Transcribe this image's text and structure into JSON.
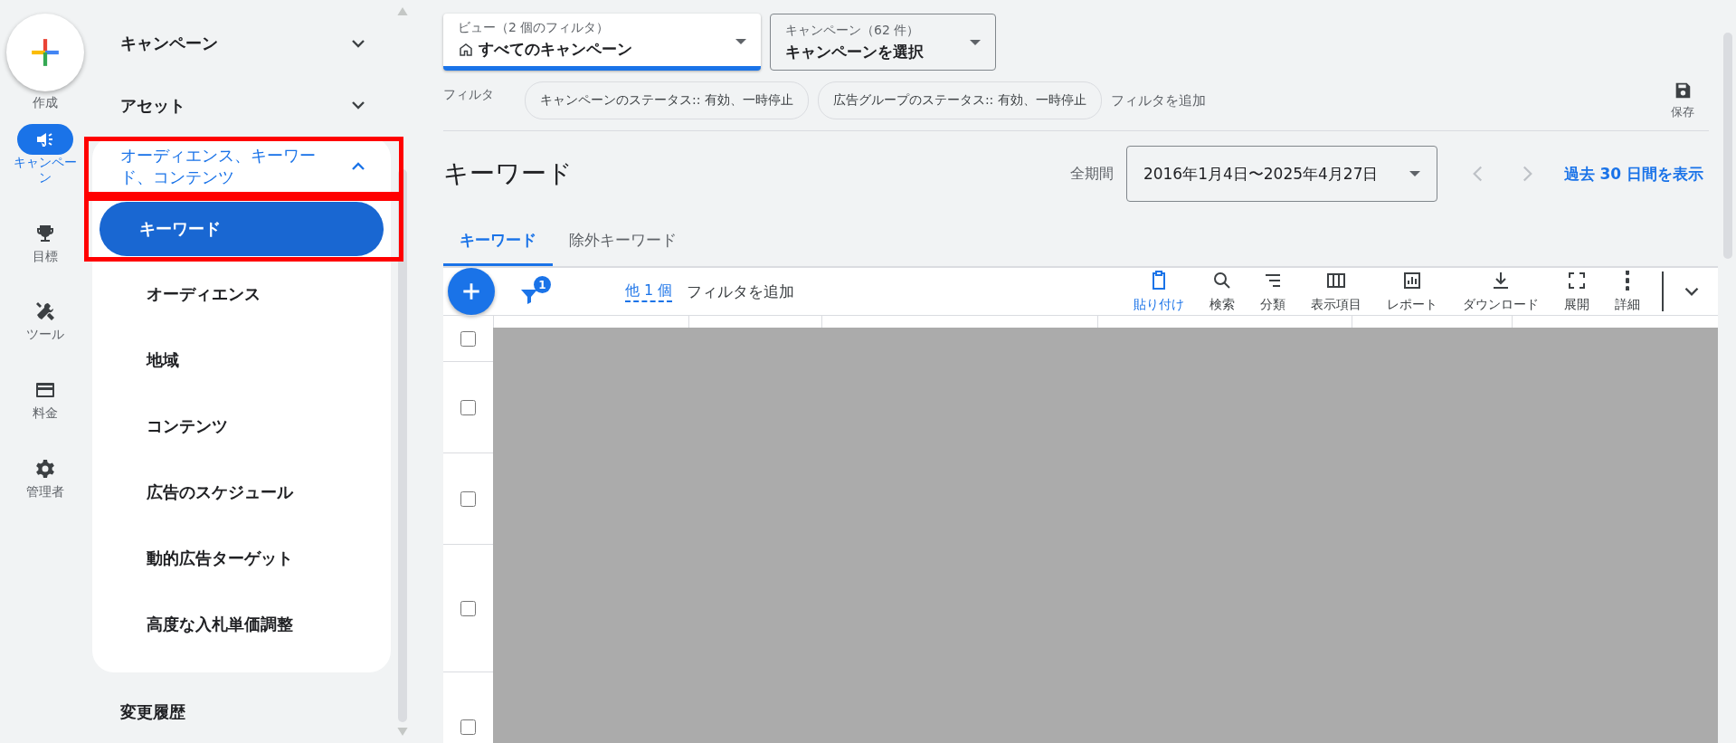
{
  "rail": {
    "create_label": "作成",
    "items": [
      {
        "label": "キャンペーン",
        "selected": true
      },
      {
        "label": "目標",
        "selected": false
      },
      {
        "label": "ツール",
        "selected": false
      },
      {
        "label": "料金",
        "selected": false
      },
      {
        "label": "管理者",
        "selected": false
      }
    ]
  },
  "sidebar": {
    "sections": [
      {
        "label": "キャンペーン",
        "expanded": false
      },
      {
        "label": "アセット",
        "expanded": false
      },
      {
        "label": "オーディエンス、キーワード、コンテンツ",
        "expanded": true,
        "annotated": true,
        "children": [
          {
            "label": "キーワード",
            "selected": true,
            "annotated": true
          },
          {
            "label": "オーディエンス",
            "selected": false,
            "annotated": false
          },
          {
            "label": "地域",
            "selected": false,
            "annotated": false
          },
          {
            "label": "コンテンツ",
            "selected": false,
            "annotated": false
          },
          {
            "label": "広告のスケジュール",
            "selected": false,
            "annotated": false
          },
          {
            "label": "動的広告ターゲット",
            "selected": false,
            "annotated": false
          },
          {
            "label": "高度な入札単価調整",
            "selected": false,
            "annotated": false
          }
        ]
      }
    ],
    "footer_item": "変更履歴"
  },
  "view_selector": {
    "label": "ビュー（2 個のフィルタ）",
    "value": "すべてのキャンペーン"
  },
  "campaign_selector": {
    "label": "キャンペーン（62 件）",
    "value": "キャンペーンを選択"
  },
  "filters": {
    "label": "フィルタ",
    "chips": [
      "キャンペーンのステータス:: 有効、一時停止",
      "広告グループのステータス:: 有効、一時停止"
    ],
    "add": "フィルタを追加",
    "save": "保存"
  },
  "page_title": "キーワード",
  "date": {
    "label": "全期間",
    "range": "2016年1月4日〜2025年4月27日",
    "link": "過去 30 日間を表示"
  },
  "tabs": [
    {
      "label": "キーワード",
      "selected": true
    },
    {
      "label": "除外キーワード",
      "selected": false
    }
  ],
  "toolbar": {
    "filter_badge": "1",
    "more_filters": "他 1 個",
    "add_filter": "フィルタを追加",
    "actions": [
      {
        "label": "貼り付け",
        "selected": true
      },
      {
        "label": "検索",
        "selected": false
      },
      {
        "label": "分類",
        "selected": false
      },
      {
        "label": "表示項目",
        "selected": false
      },
      {
        "label": "レポート",
        "selected": false
      },
      {
        "label": "ダウンロード",
        "selected": false
      },
      {
        "label": "展開",
        "selected": false
      },
      {
        "label": "詳細",
        "selected": false
      }
    ]
  },
  "table": {
    "header_checked": false,
    "rows": [
      {
        "checked": false
      },
      {
        "checked": false
      },
      {
        "checked": false
      },
      {
        "checked": false
      }
    ]
  }
}
